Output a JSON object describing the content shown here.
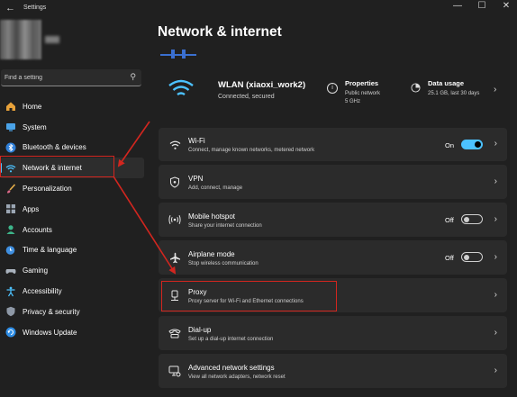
{
  "window": {
    "title": "Settings",
    "back": "←",
    "min": "—",
    "max": "☐",
    "close": "✕"
  },
  "search": {
    "placeholder": "Find a setting"
  },
  "nav": [
    {
      "label": "Home",
      "icon": "home-icon"
    },
    {
      "label": "System",
      "icon": "monitor-icon"
    },
    {
      "label": "Bluetooth & devices",
      "icon": "bluetooth-icon"
    },
    {
      "label": "Network & internet",
      "icon": "wifi-icon",
      "active": true
    },
    {
      "label": "Personalization",
      "icon": "brush-icon"
    },
    {
      "label": "Apps",
      "icon": "apps-icon"
    },
    {
      "label": "Accounts",
      "icon": "person-icon"
    },
    {
      "label": "Time & language",
      "icon": "globe-clock-icon"
    },
    {
      "label": "Gaming",
      "icon": "gamepad-icon"
    },
    {
      "label": "Accessibility",
      "icon": "accessibility-icon"
    },
    {
      "label": "Privacy & security",
      "icon": "shield-icon"
    },
    {
      "label": "Windows Update",
      "icon": "update-icon"
    }
  ],
  "page": {
    "title": "Network & internet"
  },
  "wlan": {
    "name": "WLAN (xiaoxi_work2)",
    "status": "Connected, secured",
    "properties": {
      "title": "Properties",
      "line1": "Public network",
      "line2": "5 GHz"
    },
    "data_usage": {
      "title": "Data usage",
      "detail": "25.1 GB, last 30 days"
    }
  },
  "cards": [
    {
      "title": "Wi-Fi",
      "subtitle": "Connect, manage known networks, metered network",
      "toggle_label": "On",
      "toggle_on": true,
      "icon": "wifi-icon"
    },
    {
      "title": "VPN",
      "subtitle": "Add, connect, manage",
      "icon": "vpn-shield-icon"
    },
    {
      "title": "Mobile hotspot",
      "subtitle": "Share your internet connection",
      "toggle_label": "Off",
      "toggle_on": false,
      "icon": "hotspot-icon"
    },
    {
      "title": "Airplane mode",
      "subtitle": "Stop wireless communication",
      "toggle_label": "Off",
      "toggle_on": false,
      "icon": "airplane-icon"
    },
    {
      "title": "Proxy",
      "subtitle": "Proxy server for Wi-Fi and Ethernet connections",
      "icon": "proxy-icon"
    },
    {
      "title": "Dial-up",
      "subtitle": "Set up a dial-up internet connection",
      "icon": "dialup-icon"
    },
    {
      "title": "Advanced network settings",
      "subtitle": "View all network adapters, network reset",
      "icon": "network-settings-icon"
    }
  ],
  "colors": {
    "accent": "#4cc2ff",
    "annotation": "#d2261f",
    "background": "#202020",
    "card": "#2b2b2b"
  }
}
